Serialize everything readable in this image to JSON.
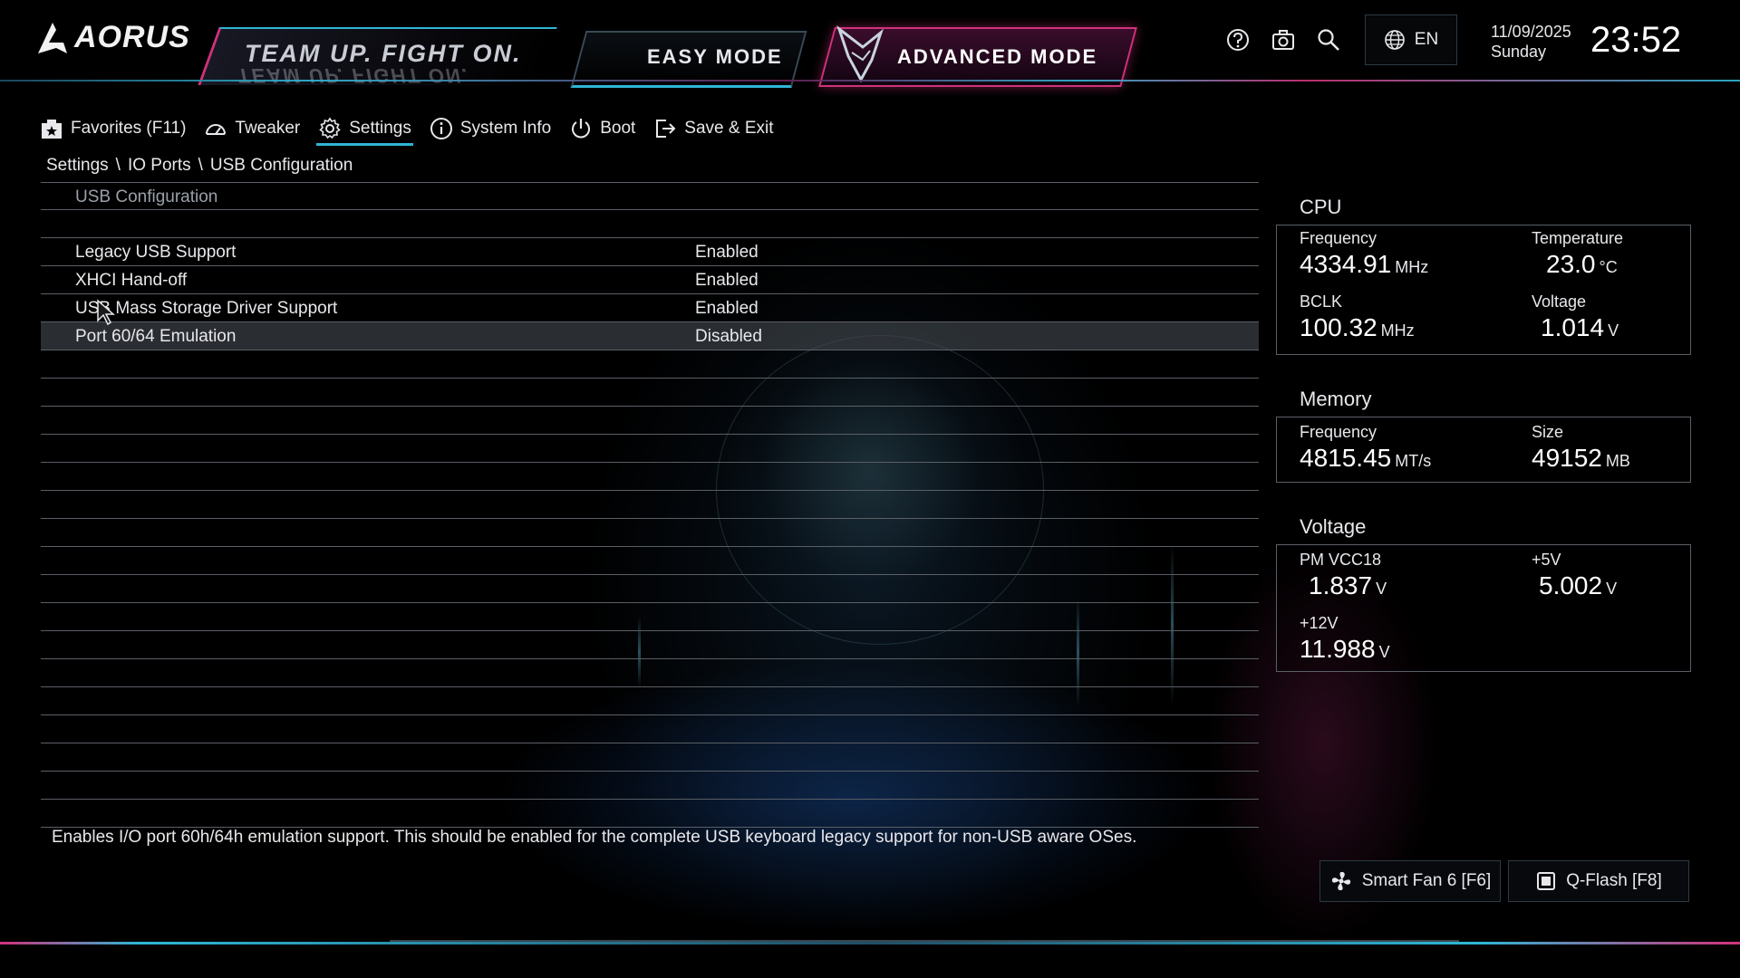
{
  "header": {
    "brand": "AORUS",
    "slogan": "TEAM UP. FIGHT ON.",
    "mode_easy": "EASY MODE",
    "mode_advanced": "ADVANCED MODE",
    "language": "EN",
    "date": "11/09/2025",
    "day": "Sunday",
    "time": "23:52",
    "icons": [
      "help-icon",
      "screenshot-camera-icon",
      "search-icon",
      "globe-icon"
    ]
  },
  "nav": {
    "favorites": "Favorites (F11)",
    "tweaker": "Tweaker",
    "settings": "Settings",
    "system_info": "System Info",
    "boot": "Boot",
    "save_exit": "Save & Exit"
  },
  "breadcrumb": {
    "part1": "Settings",
    "sep1": "\\",
    "part2": "IO Ports",
    "sep2": "\\",
    "part3": "USB Configuration"
  },
  "list": {
    "section_title": "USB Configuration",
    "items": [
      {
        "label": "Legacy USB Support",
        "value": "Enabled"
      },
      {
        "label": "XHCI Hand-off",
        "value": "Enabled"
      },
      {
        "label": "USB Mass Storage Driver Support",
        "value": "Enabled"
      },
      {
        "label": "Port 60/64 Emulation",
        "value": "Disabled"
      }
    ]
  },
  "help_text": "Enables I/O port 60h/64h emulation support. This should be enabled for the complete USB keyboard legacy support for non-USB aware OSes.",
  "cpu": {
    "title": "CPU",
    "freq_label": "Frequency",
    "freq_value": "4334.91",
    "freq_unit": "MHz",
    "temp_label": "Temperature",
    "temp_value": "23.0",
    "temp_unit": "°C",
    "bclk_label": "BCLK",
    "bclk_value": "100.32",
    "bclk_unit": "MHz",
    "volt_label": "Voltage",
    "volt_value": "1.014",
    "volt_unit": "V"
  },
  "memory": {
    "title": "Memory",
    "freq_label": "Frequency",
    "freq_value": "4815.45",
    "freq_unit": "MT/s",
    "size_label": "Size",
    "size_value": "49152",
    "size_unit": "MB"
  },
  "voltage": {
    "title": "Voltage",
    "pm_label": "PM VCC18",
    "pm_value": "1.837",
    "pm_unit": "V",
    "v5_label": "+5V",
    "v5_value": "5.002",
    "v5_unit": "V",
    "v12_label": "+12V",
    "v12_value": "11.988",
    "v12_unit": "V"
  },
  "footer": {
    "smart_fan": "Smart Fan 6 [F6]",
    "qflash": "Q-Flash [F8]"
  },
  "colors": {
    "accent_cyan": "#2fb6d6",
    "accent_magenta": "#d0327a",
    "row_selected": "#464b52"
  }
}
